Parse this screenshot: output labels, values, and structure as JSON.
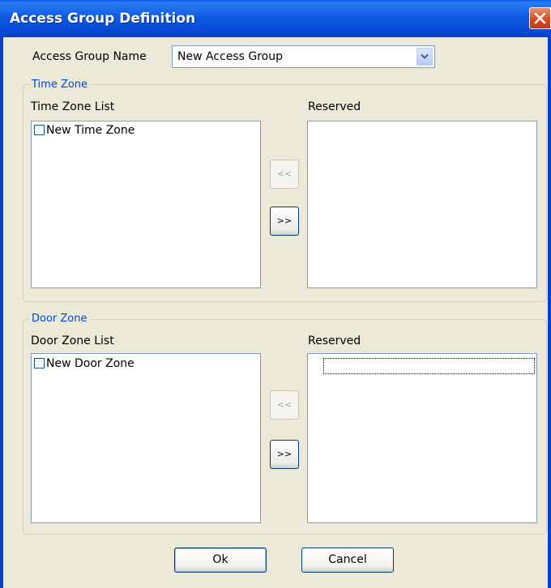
{
  "window": {
    "title": "Access Group Definition"
  },
  "access_group": {
    "label": "Access Group Name",
    "selected": "New Access Group"
  },
  "time_zone": {
    "group_label": "Time Zone",
    "list_label": "Time Zone List",
    "reserved_label": "Reserved",
    "items": [
      "New Time Zone"
    ],
    "reserved_items": [],
    "move_left_label": "<<",
    "move_right_label": ">>"
  },
  "door_zone": {
    "group_label": "Door Zone",
    "list_label": "Door Zone List",
    "reserved_label": "Reserved",
    "items": [
      "New Door Zone"
    ],
    "reserved_items": [],
    "move_left_label": "<<",
    "move_right_label": ">>"
  },
  "buttons": {
    "ok": "Ok",
    "cancel": "Cancel"
  },
  "colors": {
    "titlebar": "#0A5EEA",
    "dialog_background": "#ECE9D8",
    "group_label": "#0046D5",
    "close_button": "#D4491F"
  },
  "icons": {
    "close": "close-icon",
    "dropdown": "chevron-down-icon"
  }
}
